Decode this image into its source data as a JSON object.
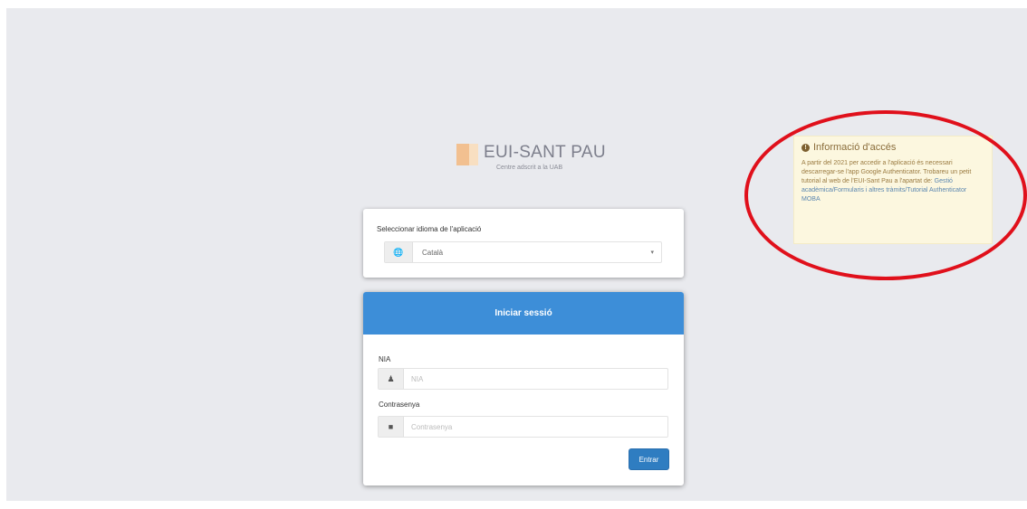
{
  "logo": {
    "title": "EUI-SANT PAU",
    "subtitle": "Centre adscrit a la UAB"
  },
  "language": {
    "label": "Seleccionar idioma de l'aplicació",
    "selected": "Català",
    "icon": "globe-icon"
  },
  "login": {
    "header": "Iniciar sessió",
    "user_label": "NIA",
    "user_placeholder": "NIA",
    "password_label": "Contrasenya",
    "password_placeholder": "Contrasenya",
    "submit_label": "Entrar"
  },
  "info": {
    "title": "Informació d'accés",
    "body": "A partir del 2021 per accedir a l'aplicació és necessari descarregar-se l'app Google Authenticator. Trobareu un petit tutorial al web de l'EUI-Sant Pau a l'apartat de:",
    "link": "Gestió acadèmica/Formularis i altres tràmits/Tutorial Authenticator MOBA"
  },
  "colors": {
    "header_blue": "#3d8ed8",
    "button_blue": "#2f7dc1",
    "annotation_red": "#e0101b",
    "info_bg": "#fcf7df"
  }
}
